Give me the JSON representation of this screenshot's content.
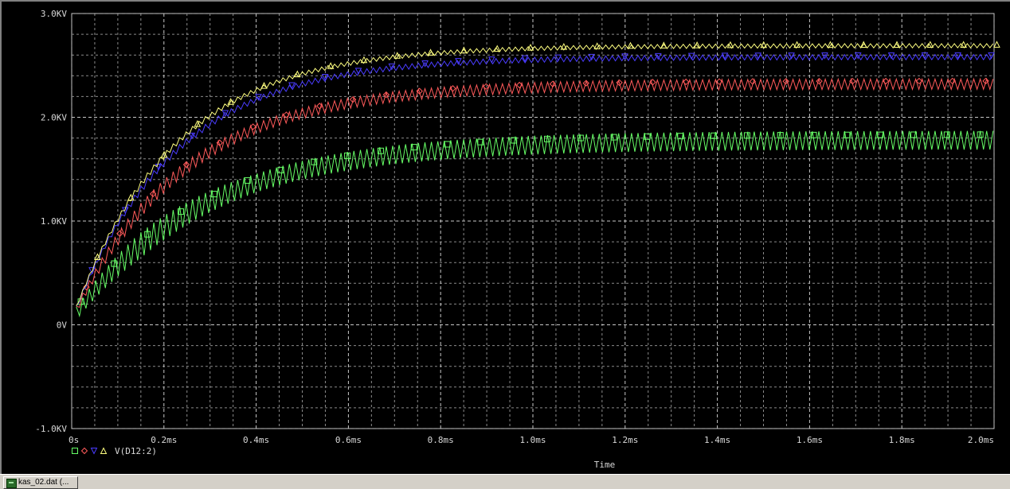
{
  "chart_data": {
    "type": "line",
    "xlabel": "Time",
    "ylabel": "",
    "xlim": [
      0,
      2.0
    ],
    "ylim": [
      -1.0,
      3.0
    ],
    "x_ticks": [
      0,
      0.2,
      0.4,
      0.6,
      0.8,
      1.0,
      1.2,
      1.4,
      1.6,
      1.8,
      2.0
    ],
    "x_tick_labels": [
      "0s",
      "0.2ms",
      "0.4ms",
      "0.6ms",
      "0.8ms",
      "1.0ms",
      "1.2ms",
      "1.4ms",
      "1.6ms",
      "1.8ms",
      "2.0ms"
    ],
    "y_ticks": [
      -1.0,
      0,
      1.0,
      2.0,
      3.0
    ],
    "y_tick_labels": [
      "-1.0KV",
      "0V",
      "1.0KV",
      "2.0KV",
      "3.0KV"
    ],
    "grid": true,
    "background": "#000000",
    "legend_text": "V(D12:2)",
    "series": [
      {
        "marker": "square",
        "color": "#66ff66",
        "final_mid": 1.78,
        "amplitude": 0.09,
        "tau": 0.28,
        "start": 0.05,
        "note_shape": "ramp"
      },
      {
        "marker": "diamond",
        "color": "#ff5a5a",
        "final_mid": 2.32,
        "amplitude": 0.05,
        "tau": 0.24,
        "start": 0.05
      },
      {
        "marker": "triangle-down",
        "color": "#4a3cff",
        "final_mid": 2.58,
        "amplitude": 0.025,
        "tau": 0.22,
        "start": 0.05
      },
      {
        "marker": "triangle-up",
        "color": "#ffff80",
        "final_mid": 2.69,
        "amplitude": 0.02,
        "tau": 0.22,
        "start": 0.05
      }
    ]
  },
  "taskbar": {
    "item_label": "kas_02.dat (..."
  }
}
